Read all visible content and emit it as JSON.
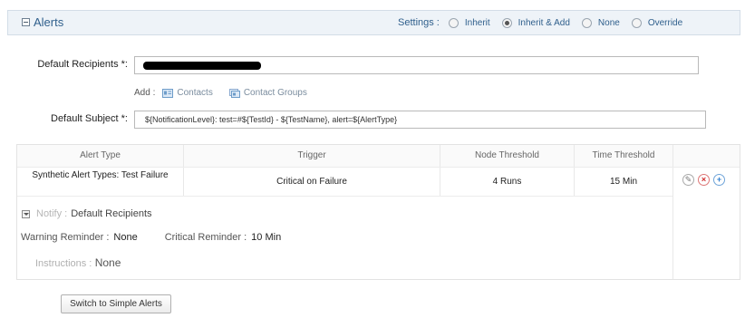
{
  "section": {
    "title": "Alerts"
  },
  "settings": {
    "label": "Settings :",
    "options": [
      {
        "label": "Inherit",
        "selected": false
      },
      {
        "label": "Inherit & Add",
        "selected": true
      },
      {
        "label": "None",
        "selected": false
      },
      {
        "label": "Override",
        "selected": false
      }
    ]
  },
  "form": {
    "recipients_label": "Default Recipients *:",
    "recipients_value": "[redacted]",
    "add_label": "Add :",
    "add_contacts": "Contacts",
    "add_groups": "Contact Groups",
    "subject_label": "Default Subject *:",
    "subject_value": "${NotificationLevel}:  test=#${TestId} - ${TestName}, alert=${AlertType}"
  },
  "table": {
    "headers": {
      "type": "Alert Type",
      "trigger": "Trigger",
      "node": "Node Threshold",
      "time": "Time Threshold"
    },
    "rows": [
      {
        "type": "Synthetic Alert Types: Test Failure",
        "trigger": "Critical on Failure",
        "node": "4 Runs",
        "time": "15 Min"
      }
    ]
  },
  "notify": {
    "label": "Notify :",
    "value": "Default Recipients"
  },
  "reminders": {
    "warning_label": "Warning Reminder :",
    "warning_value": "None",
    "critical_label": "Critical Reminder :",
    "critical_value": "10 Min"
  },
  "instructions": {
    "label": "Instructions :",
    "value": "None"
  },
  "buttons": {
    "switch_simple": "Switch to Simple Alerts"
  },
  "colors": {
    "accent": "#2f5f8c",
    "header_bg": "#eef3f8",
    "delete": "#d02a2a",
    "add": "#2f7fd0"
  },
  "icons": [
    "collapse-icon",
    "contacts-card-icon",
    "contact-groups-icon",
    "edit-icon",
    "delete-icon",
    "add-icon",
    "expand-chevron-icon"
  ]
}
